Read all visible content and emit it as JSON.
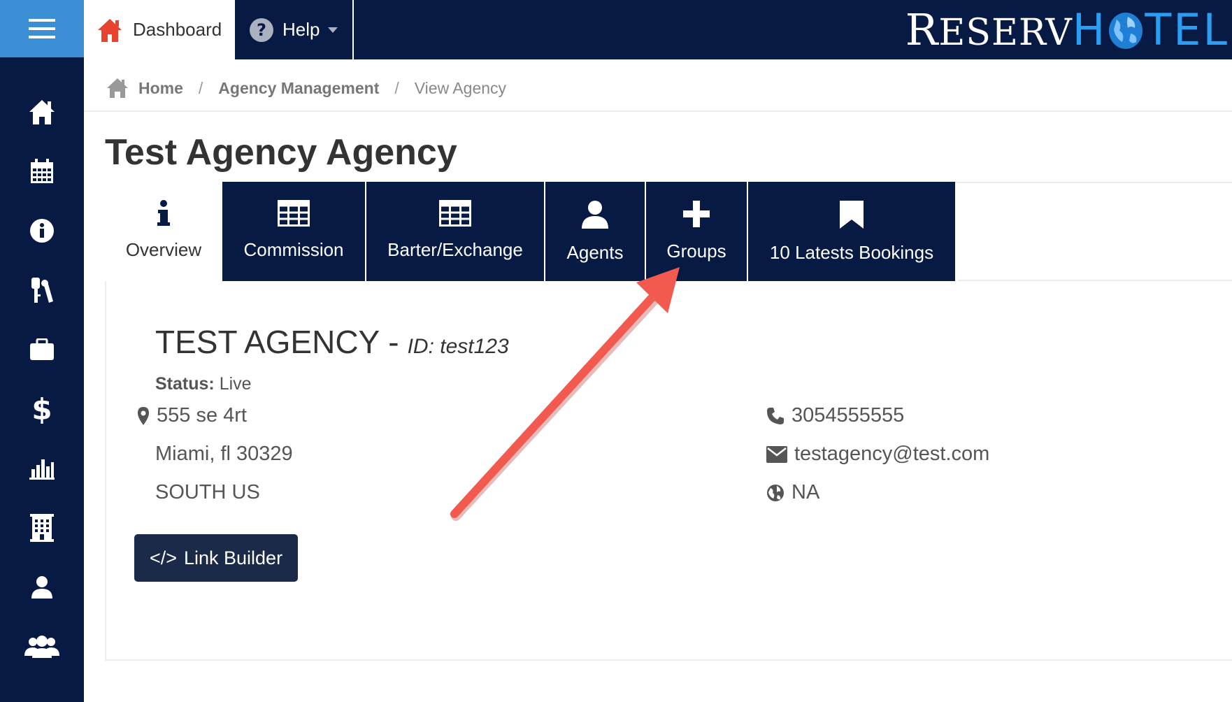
{
  "topbar": {
    "dashboard_label": "Dashboard",
    "help_label": "Help",
    "logo_part1_first": "R",
    "logo_part1_rest": "ESERV",
    "logo_part2_first": "H",
    "logo_part2_rest": "TEL"
  },
  "breadcrumb": {
    "home": "Home",
    "sep1": "/",
    "agency_management": "Agency Management",
    "sep2": "/",
    "current": "View Agency"
  },
  "page": {
    "title": "Test Agency Agency"
  },
  "tabs": [
    {
      "label": "Overview",
      "icon": "info-icon"
    },
    {
      "label": "Commission",
      "icon": "table-icon"
    },
    {
      "label": "Barter/Exchange",
      "icon": "table-icon"
    },
    {
      "label": "Agents",
      "icon": "user-icon"
    },
    {
      "label": "Groups",
      "icon": "plus-icon"
    },
    {
      "label": "10 Latests Bookings",
      "icon": "bookmark-icon"
    }
  ],
  "overview": {
    "agency_name": "TEST AGENCY",
    "dash": "-",
    "id_label": "ID: test123",
    "status_label": "Status:",
    "status_value": "Live",
    "address_line1": "555 se 4rt",
    "address_line2": "Miami, fl 30329",
    "address_line3": "SOUTH US",
    "phone": "3054555555",
    "email": "testagency@test.com",
    "website": "NA",
    "link_builder_label": "Link Builder",
    "link_builder_icon": "</>"
  },
  "colors": {
    "navy": "#061a44",
    "menu_blue": "#3b8ed4",
    "home_red": "#e8432e",
    "arrow": "#f25a4f",
    "logo_blue": "#2a9df4"
  },
  "sidebar": {
    "icons": [
      "home-icon",
      "calendar-icon",
      "info-icon",
      "keys-icon",
      "briefcase-icon",
      "dollar-icon",
      "bar-chart-icon",
      "building-icon",
      "user-icon",
      "users-icon"
    ]
  }
}
